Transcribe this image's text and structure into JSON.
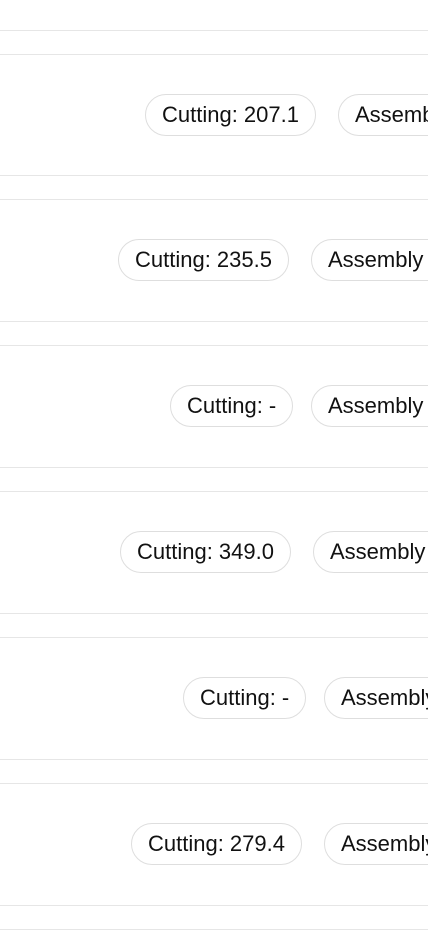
{
  "rows": [
    {
      "cutting_label": "Cutting: 207.1",
      "assembly_label": "Assembly"
    },
    {
      "cutting_label": "Cutting: 235.5",
      "assembly_label": "Assembly"
    },
    {
      "cutting_label": "Cutting: -",
      "assembly_label": "Assembly"
    },
    {
      "cutting_label": "Cutting: 349.0",
      "assembly_label": "Assembly"
    },
    {
      "cutting_label": "Cutting: -",
      "assembly_label": "Assembly"
    },
    {
      "cutting_label": "Cutting: 279.4",
      "assembly_label": "Assembly"
    }
  ],
  "colors": {
    "background": "#ffffff",
    "divider": "#e6e6e6",
    "chip_border": "#dedede",
    "text": "#111111"
  }
}
